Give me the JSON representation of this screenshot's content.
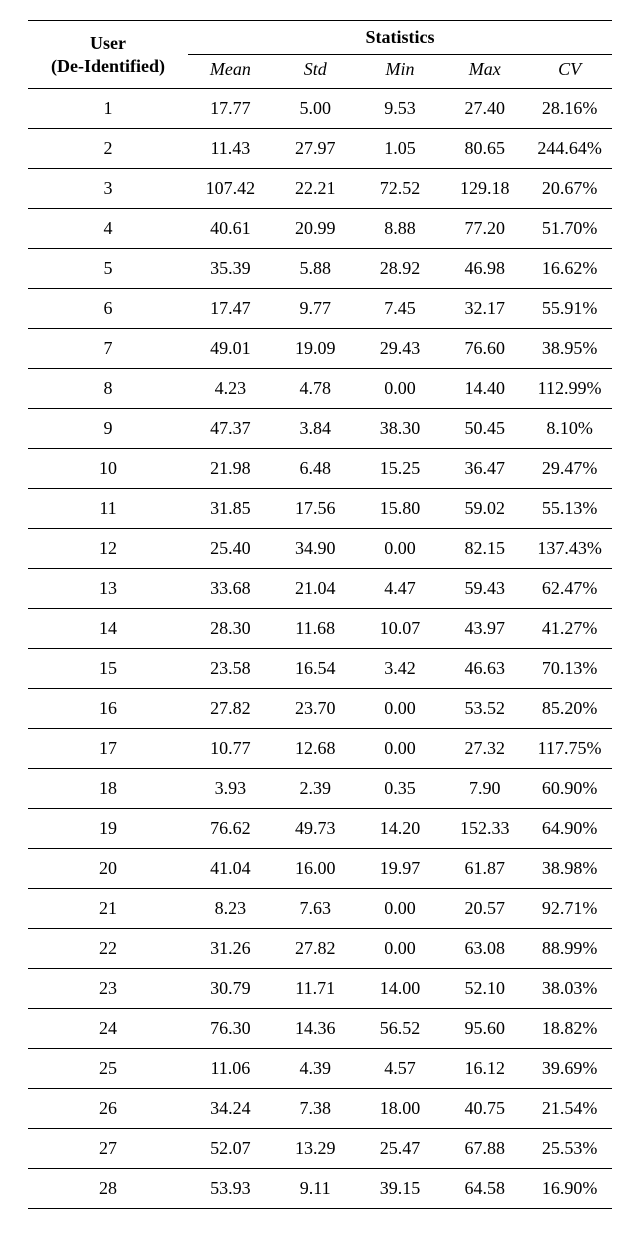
{
  "header": {
    "user_line1": "User",
    "user_line2": "(De-Identified)",
    "stats_label": "Statistics",
    "sub": {
      "mean": "Mean",
      "std": "Std",
      "min": "Min",
      "max": "Max",
      "cv": "CV"
    }
  },
  "rows": [
    {
      "user": "1",
      "mean": "17.77",
      "std": "5.00",
      "min": "9.53",
      "max": "27.40",
      "cv": "28.16%"
    },
    {
      "user": "2",
      "mean": "11.43",
      "std": "27.97",
      "min": "1.05",
      "max": "80.65",
      "cv": "244.64%"
    },
    {
      "user": "3",
      "mean": "107.42",
      "std": "22.21",
      "min": "72.52",
      "max": "129.18",
      "cv": "20.67%"
    },
    {
      "user": "4",
      "mean": "40.61",
      "std": "20.99",
      "min": "8.88",
      "max": "77.20",
      "cv": "51.70%"
    },
    {
      "user": "5",
      "mean": "35.39",
      "std": "5.88",
      "min": "28.92",
      "max": "46.98",
      "cv": "16.62%"
    },
    {
      "user": "6",
      "mean": "17.47",
      "std": "9.77",
      "min": "7.45",
      "max": "32.17",
      "cv": "55.91%"
    },
    {
      "user": "7",
      "mean": "49.01",
      "std": "19.09",
      "min": "29.43",
      "max": "76.60",
      "cv": "38.95%"
    },
    {
      "user": "8",
      "mean": "4.23",
      "std": "4.78",
      "min": "0.00",
      "max": "14.40",
      "cv": "112.99%"
    },
    {
      "user": "9",
      "mean": "47.37",
      "std": "3.84",
      "min": "38.30",
      "max": "50.45",
      "cv": "8.10%"
    },
    {
      "user": "10",
      "mean": "21.98",
      "std": "6.48",
      "min": "15.25",
      "max": "36.47",
      "cv": "29.47%"
    },
    {
      "user": "11",
      "mean": "31.85",
      "std": "17.56",
      "min": "15.80",
      "max": "59.02",
      "cv": "55.13%"
    },
    {
      "user": "12",
      "mean": "25.40",
      "std": "34.90",
      "min": "0.00",
      "max": "82.15",
      "cv": "137.43%"
    },
    {
      "user": "13",
      "mean": "33.68",
      "std": "21.04",
      "min": "4.47",
      "max": "59.43",
      "cv": "62.47%"
    },
    {
      "user": "14",
      "mean": "28.30",
      "std": "11.68",
      "min": "10.07",
      "max": "43.97",
      "cv": "41.27%"
    },
    {
      "user": "15",
      "mean": "23.58",
      "std": "16.54",
      "min": "3.42",
      "max": "46.63",
      "cv": "70.13%"
    },
    {
      "user": "16",
      "mean": "27.82",
      "std": "23.70",
      "min": "0.00",
      "max": "53.52",
      "cv": "85.20%"
    },
    {
      "user": "17",
      "mean": "10.77",
      "std": "12.68",
      "min": "0.00",
      "max": "27.32",
      "cv": "117.75%"
    },
    {
      "user": "18",
      "mean": "3.93",
      "std": "2.39",
      "min": "0.35",
      "max": "7.90",
      "cv": "60.90%"
    },
    {
      "user": "19",
      "mean": "76.62",
      "std": "49.73",
      "min": "14.20",
      "max": "152.33",
      "cv": "64.90%"
    },
    {
      "user": "20",
      "mean": "41.04",
      "std": "16.00",
      "min": "19.97",
      "max": "61.87",
      "cv": "38.98%"
    },
    {
      "user": "21",
      "mean": "8.23",
      "std": "7.63",
      "min": "0.00",
      "max": "20.57",
      "cv": "92.71%"
    },
    {
      "user": "22",
      "mean": "31.26",
      "std": "27.82",
      "min": "0.00",
      "max": "63.08",
      "cv": "88.99%"
    },
    {
      "user": "23",
      "mean": "30.79",
      "std": "11.71",
      "min": "14.00",
      "max": "52.10",
      "cv": "38.03%"
    },
    {
      "user": "24",
      "mean": "76.30",
      "std": "14.36",
      "min": "56.52",
      "max": "95.60",
      "cv": "18.82%"
    },
    {
      "user": "25",
      "mean": "11.06",
      "std": "4.39",
      "min": "4.57",
      "max": "16.12",
      "cv": "39.69%"
    },
    {
      "user": "26",
      "mean": "34.24",
      "std": "7.38",
      "min": "18.00",
      "max": "40.75",
      "cv": "21.54%"
    },
    {
      "user": "27",
      "mean": "52.07",
      "std": "13.29",
      "min": "25.47",
      "max": "67.88",
      "cv": "25.53%"
    },
    {
      "user": "28",
      "mean": "53.93",
      "std": "9.11",
      "min": "39.15",
      "max": "64.58",
      "cv": "16.90%"
    }
  ]
}
